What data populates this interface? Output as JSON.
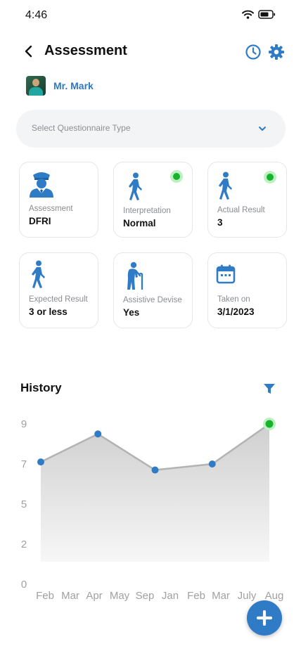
{
  "status_bar": {
    "time": "4:46",
    "wifi_icon": "wifi-icon",
    "battery_icon": "battery-icon"
  },
  "header": {
    "title": "Assessment",
    "back_icon": "chevron-left-icon",
    "history_icon": "clock-icon",
    "settings_icon": "gear-icon"
  },
  "user": {
    "name": "Mr. Mark"
  },
  "questionnaire_select": {
    "placeholder": "Select Questionnaire Type"
  },
  "cards": [
    {
      "icon": "police-officer-icon",
      "label": "Assessment",
      "value": "DFRI",
      "status": null
    },
    {
      "icon": "walking-person-icon",
      "label": "Interpretation",
      "value": "Normal",
      "status": "green"
    },
    {
      "icon": "walking-person-icon",
      "label": "Actual Result",
      "value": "3",
      "status": "green"
    },
    {
      "icon": "walking-person-icon",
      "label": "Expected Result",
      "value": "3 or less",
      "status": null
    },
    {
      "icon": "elderly-cane-icon",
      "label": "Assistive Devise",
      "value": "Yes",
      "status": null
    },
    {
      "icon": "calendar-icon",
      "label": "Taken on",
      "value": "3/1/2023",
      "status": null
    }
  ],
  "history": {
    "title": "History",
    "filter_icon": "filter-icon"
  },
  "colors": {
    "primary": "#2f7bc6",
    "status_green": "#16b32c",
    "text_muted": "#8a8d91"
  },
  "chart_data": {
    "type": "area",
    "categories": [
      "Feb",
      "Mar",
      "Apr",
      "May",
      "Sep",
      "Jan",
      "Feb",
      "Mar",
      "July",
      "Aug"
    ],
    "y_ticks": [
      0,
      2,
      5,
      7,
      9
    ],
    "ylim": [
      0,
      9
    ],
    "points": [
      {
        "x": "Feb",
        "y": 7.1
      },
      {
        "x": "Apr",
        "y": 8.5
      },
      {
        "x": "Sep",
        "y": 6.7
      },
      {
        "x": "Feb",
        "y": 7.0
      },
      {
        "x": "Aug",
        "y": 9.0,
        "highlight": true
      }
    ],
    "grid": false,
    "legend": "none"
  },
  "fab": {
    "icon": "plus-icon"
  }
}
